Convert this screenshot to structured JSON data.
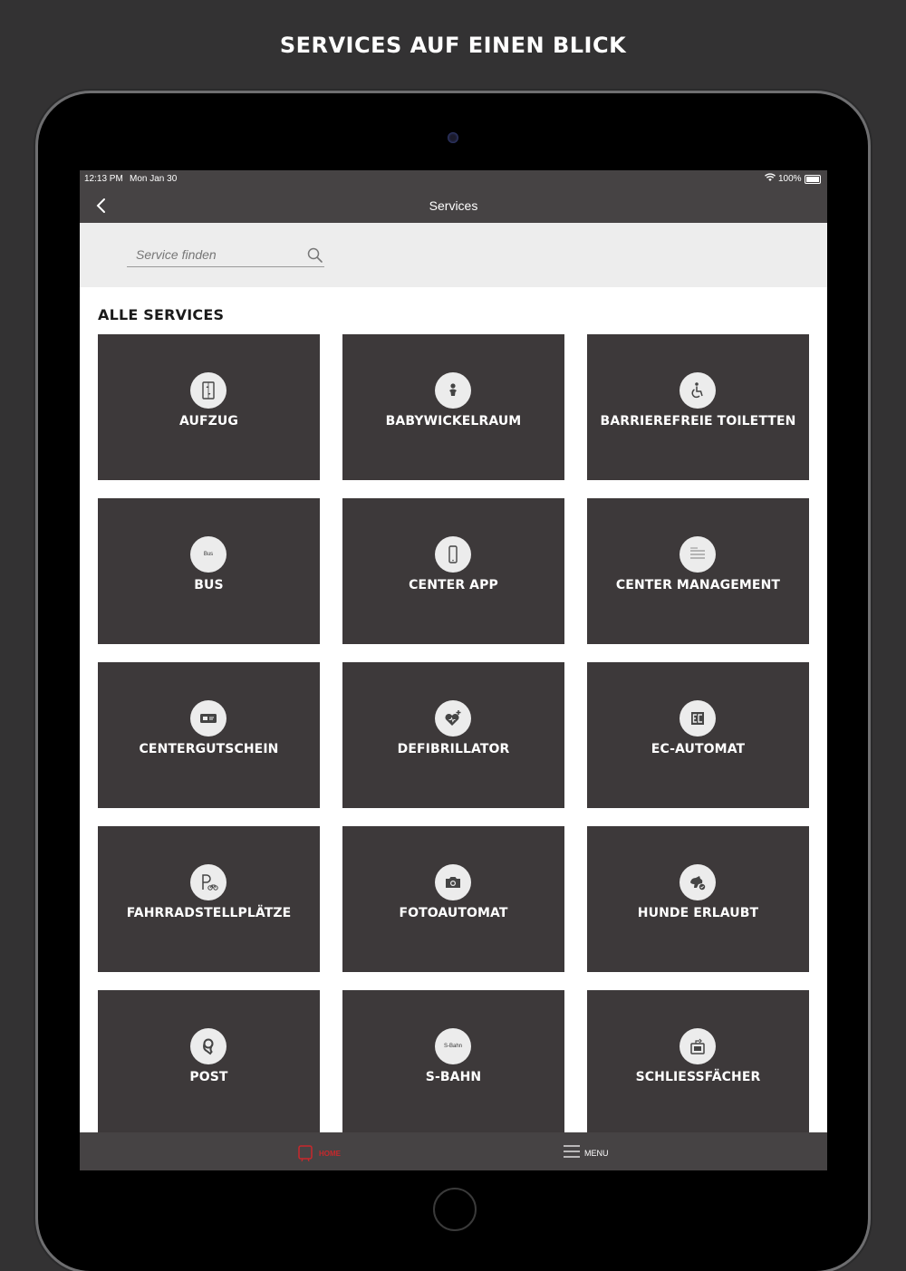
{
  "headline": "SERVICES AUF EINEN BLICK",
  "status": {
    "time": "12:13 PM",
    "date": "Mon Jan 30",
    "battery": "100%"
  },
  "nav": {
    "title": "Services"
  },
  "search": {
    "placeholder": "Service finden"
  },
  "section_title": "ALLE SERVICES",
  "services": [
    {
      "label": "AUFZUG",
      "icon": "elevator-icon"
    },
    {
      "label": "BABYWICKELRAUM",
      "icon": "baby-icon"
    },
    {
      "label": "BARRIEREFREIE TOILETTEN",
      "icon": "wheelchair-icon"
    },
    {
      "label": "BUS",
      "icon": "bus-icon",
      "icon_text": "Bus"
    },
    {
      "label": "CENTER APP",
      "icon": "smartphone-icon"
    },
    {
      "label": "CENTER MANAGEMENT",
      "icon": "document-icon"
    },
    {
      "label": "CENTERGUTSCHEIN",
      "icon": "voucher-icon"
    },
    {
      "label": "DEFIBRILLATOR",
      "icon": "heart-plus-icon"
    },
    {
      "label": "EC-AUTOMAT",
      "icon": "ec-icon"
    },
    {
      "label": "FAHRRADSTELLPLÄTZE",
      "icon": "bike-parking-icon"
    },
    {
      "label": "FOTOAUTOMAT",
      "icon": "camera-icon"
    },
    {
      "label": "HUNDE ERLAUBT",
      "icon": "dog-icon"
    },
    {
      "label": "POST",
      "icon": "post-horn-icon"
    },
    {
      "label": "S-BAHN",
      "icon": "sbahn-icon",
      "icon_text": "S-Bahn"
    },
    {
      "label": "SCHLIESSFÄCHER",
      "icon": "locker-icon"
    }
  ],
  "tabbar": {
    "home_label": "HOME",
    "menu_label": "MENU"
  },
  "colors": {
    "tile": "#3d393a",
    "bar": "#464344",
    "accent": "#c8282c"
  }
}
